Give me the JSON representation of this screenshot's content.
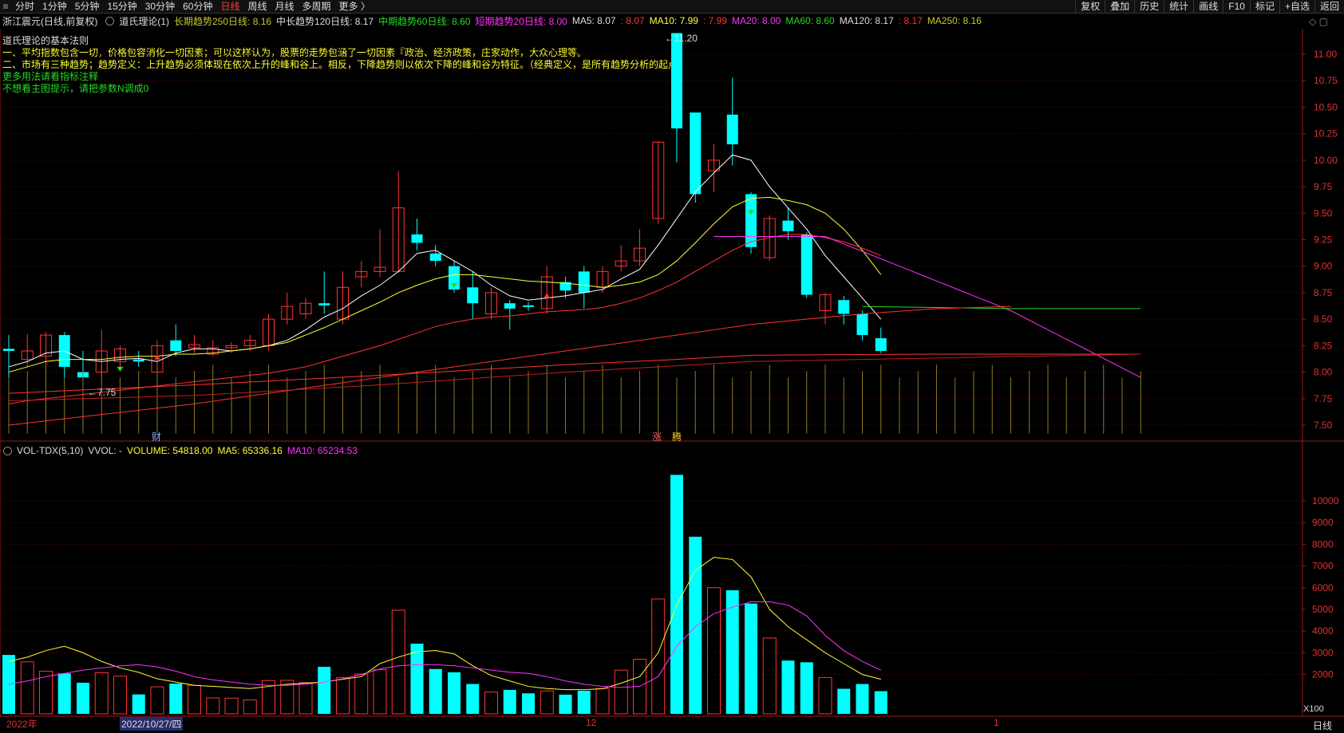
{
  "toolbar": {
    "menu_icon": "menu-icon",
    "periods": [
      "分时",
      "1分钟",
      "5分钟",
      "15分钟",
      "30分钟",
      "60分钟",
      "日线",
      "周线",
      "月线",
      "多周期",
      "更多 〉"
    ],
    "active_period": "日线",
    "right_buttons": [
      "复权",
      "叠加",
      "历史",
      "统计",
      "画线",
      "F10",
      "标记",
      "+自选",
      "返回"
    ]
  },
  "header": {
    "stock": "浙江震元(日线,前复权)",
    "indicator": "道氏理论(1)",
    "items": [
      {
        "text": "长期趋势250日线: 8.16",
        "color": "#c8c832"
      },
      {
        "text": "中长趋势120日线: 8.17",
        "color": "#dddddd"
      },
      {
        "text": "中期趋势60日线: 8.60",
        "color": "#22dd22"
      },
      {
        "text": "短期趋势20日线: 8.00",
        "color": "#ff33ff"
      },
      {
        "text": "MA5: 8.07",
        "color": "#dddddd"
      },
      {
        "text": ": 8.07",
        "color": "#ff3333"
      },
      {
        "text": "MA10: 7.99",
        "color": "#ffff33"
      },
      {
        "text": ": 7.99",
        "color": "#ff3333"
      },
      {
        "text": "MA20: 8.00",
        "color": "#ff33ff"
      },
      {
        "text": "MA60: 8.60",
        "color": "#22dd22"
      },
      {
        "text": "MA120: 8.17",
        "color": "#dddddd"
      },
      {
        "text": ": 8.17",
        "color": "#ff3333"
      },
      {
        "text": "MA250: 8.16",
        "color": "#c8c832"
      }
    ]
  },
  "description": [
    {
      "text": "道氏理论的基本法则",
      "color": "#dddddd"
    },
    {
      "text": "一、平均指数包含一切，价格包容消化一切因素；可以这样认为，股票的走势包涵了一切因素『政治、经济政策，庄家动作，大众心理等。",
      "color": "#ffff33"
    },
    {
      "text": "二、市场有三种趋势；趋势定义：上升趋势必须体现在依次上升的峰和谷上。相反，下降趋势则以依次下降的峰和谷为特征。（经典定义，是所有趋势分析的起点）",
      "color": "#ffff33"
    },
    {
      "text": "更多用法请看指标注释",
      "color": "#22dd22"
    },
    {
      "text": "不想看主图提示，请把参数N调成0",
      "color": "#22dd22"
    }
  ],
  "price_axis": [
    "11.00",
    "10.75",
    "10.50",
    "10.25",
    "10.00",
    "9.75",
    "9.50",
    "9.25",
    "9.00",
    "8.75",
    "8.50",
    "8.25",
    "8.00",
    "7.75",
    "7.50"
  ],
  "volume_axis": [
    "10000",
    "9000",
    "8000",
    "7000",
    "6000",
    "5000",
    "4000",
    "3000",
    "2000"
  ],
  "volume_unit": "X100",
  "annotations": {
    "high": "11.20",
    "low": "7.75",
    "cai": "财",
    "zhang": "涨",
    "teng": "腾"
  },
  "volume_header": {
    "name": "VOL-TDX(5,10)",
    "vvol": "VVOL: -",
    "volume": "VOLUME: 54818.00",
    "ma5": "MA5: 65336.16",
    "ma10": "MA10: 65234.53"
  },
  "date_axis": {
    "year": "2022年",
    "date": "2022/10/27/四",
    "dec": "12",
    "jan": "1"
  },
  "period_label": "日线",
  "colors": {
    "up": "#ff3333",
    "down": "#00ffff",
    "ma5": "#ffffff",
    "ma10": "#ffff33",
    "ma20": "#ff33ff",
    "ma60": "#22dd22",
    "ma120": "#ff3333",
    "ma250": "#ff3333"
  },
  "chart_data": {
    "type": "candlestick",
    "candles": [
      [
        8.22,
        8.2,
        8.35,
        7.95,
        "d"
      ],
      [
        8.12,
        8.2,
        8.36,
        8.05,
        "u"
      ],
      [
        8.15,
        8.35,
        8.38,
        8.05,
        "u"
      ],
      [
        8.35,
        8.05,
        8.38,
        7.95,
        "d"
      ],
      [
        8.0,
        7.95,
        8.2,
        7.85,
        "d"
      ],
      [
        8.0,
        8.2,
        8.4,
        7.95,
        "u"
      ],
      [
        8.1,
        8.22,
        8.25,
        8.05,
        "u"
      ],
      [
        8.12,
        8.1,
        8.2,
        8.05,
        "d"
      ],
      [
        8.0,
        8.25,
        8.3,
        7.98,
        "u"
      ],
      [
        8.3,
        8.2,
        8.45,
        8.15,
        "d"
      ],
      [
        8.23,
        8.26,
        8.35,
        8.18,
        "u"
      ],
      [
        8.17,
        8.23,
        8.3,
        8.15,
        "u"
      ],
      [
        8.25,
        8.23,
        8.28,
        8.18,
        "u"
      ],
      [
        8.25,
        8.3,
        8.35,
        8.2,
        "u"
      ],
      [
        8.25,
        8.5,
        8.55,
        8.2,
        "u"
      ],
      [
        8.5,
        8.62,
        8.75,
        8.45,
        "u"
      ],
      [
        8.55,
        8.65,
        8.7,
        8.5,
        "u"
      ],
      [
        8.65,
        8.63,
        8.95,
        8.55,
        "d"
      ],
      [
        8.5,
        8.8,
        8.95,
        8.45,
        "u"
      ],
      [
        8.9,
        8.95,
        9.05,
        8.8,
        "u"
      ],
      [
        8.95,
        8.99,
        9.35,
        8.9,
        "u"
      ],
      [
        8.95,
        9.55,
        9.9,
        8.95,
        "u"
      ],
      [
        9.3,
        9.22,
        9.45,
        9.15,
        "d"
      ],
      [
        9.12,
        9.05,
        9.2,
        9.0,
        "d"
      ],
      [
        9.0,
        8.78,
        9.05,
        8.75,
        "d"
      ],
      [
        8.8,
        8.65,
        8.95,
        8.5,
        "d"
      ],
      [
        8.55,
        8.75,
        8.8,
        8.5,
        "u"
      ],
      [
        8.65,
        8.6,
        8.68,
        8.4,
        "d"
      ],
      [
        8.63,
        8.62,
        8.66,
        8.58,
        "d"
      ],
      [
        8.6,
        8.9,
        9.0,
        8.55,
        "u"
      ],
      [
        8.85,
        8.77,
        8.9,
        8.7,
        "d"
      ],
      [
        8.75,
        8.95,
        9.0,
        8.6,
        "d"
      ],
      [
        8.8,
        8.95,
        9.0,
        8.75,
        "u"
      ],
      [
        9.0,
        9.05,
        9.2,
        8.95,
        "u"
      ],
      [
        9.05,
        9.17,
        9.35,
        9.0,
        "u"
      ],
      [
        9.45,
        10.17,
        10.18,
        9.4,
        "u"
      ],
      [
        11.2,
        10.3,
        11.2,
        9.98,
        "d"
      ],
      [
        10.45,
        9.68,
        10.45,
        9.6,
        "d"
      ],
      [
        9.9,
        10.0,
        10.15,
        9.7,
        "u"
      ],
      [
        10.43,
        10.15,
        10.78,
        9.95,
        "d"
      ],
      [
        9.68,
        9.18,
        9.7,
        9.12,
        "d"
      ],
      [
        9.08,
        9.45,
        9.48,
        9.05,
        "u"
      ],
      [
        9.43,
        9.33,
        9.55,
        9.25,
        "d"
      ],
      [
        9.3,
        8.73,
        9.32,
        8.7,
        "d"
      ],
      [
        8.58,
        8.73,
        8.75,
        8.45,
        "u"
      ],
      [
        8.68,
        8.55,
        8.72,
        8.45,
        "d"
      ],
      [
        8.55,
        8.35,
        8.58,
        8.3,
        "d"
      ],
      [
        8.32,
        8.2,
        8.42,
        8.18,
        "d"
      ]
    ],
    "volumes": [
      [
        2900,
        "d"
      ],
      [
        2580,
        "u"
      ],
      [
        2150,
        "u"
      ],
      [
        2050,
        "d"
      ],
      [
        1620,
        "d"
      ],
      [
        2080,
        "u"
      ],
      [
        1920,
        "u"
      ],
      [
        1080,
        "d"
      ],
      [
        1430,
        "u"
      ],
      [
        1580,
        "d"
      ],
      [
        1500,
        "u"
      ],
      [
        920,
        "u"
      ],
      [
        910,
        "u"
      ],
      [
        830,
        "u"
      ],
      [
        1720,
        "u"
      ],
      [
        1730,
        "u"
      ],
      [
        1620,
        "u"
      ],
      [
        2350,
        "d"
      ],
      [
        1850,
        "u"
      ],
      [
        2020,
        "u"
      ],
      [
        2220,
        "u"
      ],
      [
        4960,
        "u"
      ],
      [
        3420,
        "d"
      ],
      [
        2250,
        "d"
      ],
      [
        2100,
        "d"
      ],
      [
        1560,
        "d"
      ],
      [
        1190,
        "u"
      ],
      [
        1290,
        "d"
      ],
      [
        1130,
        "d"
      ],
      [
        1240,
        "u"
      ],
      [
        1070,
        "d"
      ],
      [
        1250,
        "d"
      ],
      [
        1350,
        "u"
      ],
      [
        2200,
        "u"
      ],
      [
        2700,
        "u"
      ],
      [
        5480,
        "u"
      ],
      [
        11200,
        "d"
      ],
      [
        8350,
        "d"
      ],
      [
        6000,
        "u"
      ],
      [
        5880,
        "d"
      ],
      [
        5270,
        "d"
      ],
      [
        3680,
        "u"
      ],
      [
        2640,
        "d"
      ],
      [
        2560,
        "d"
      ],
      [
        1860,
        "u"
      ],
      [
        1340,
        "d"
      ],
      [
        1560,
        "d"
      ],
      [
        1230,
        "d"
      ]
    ]
  }
}
